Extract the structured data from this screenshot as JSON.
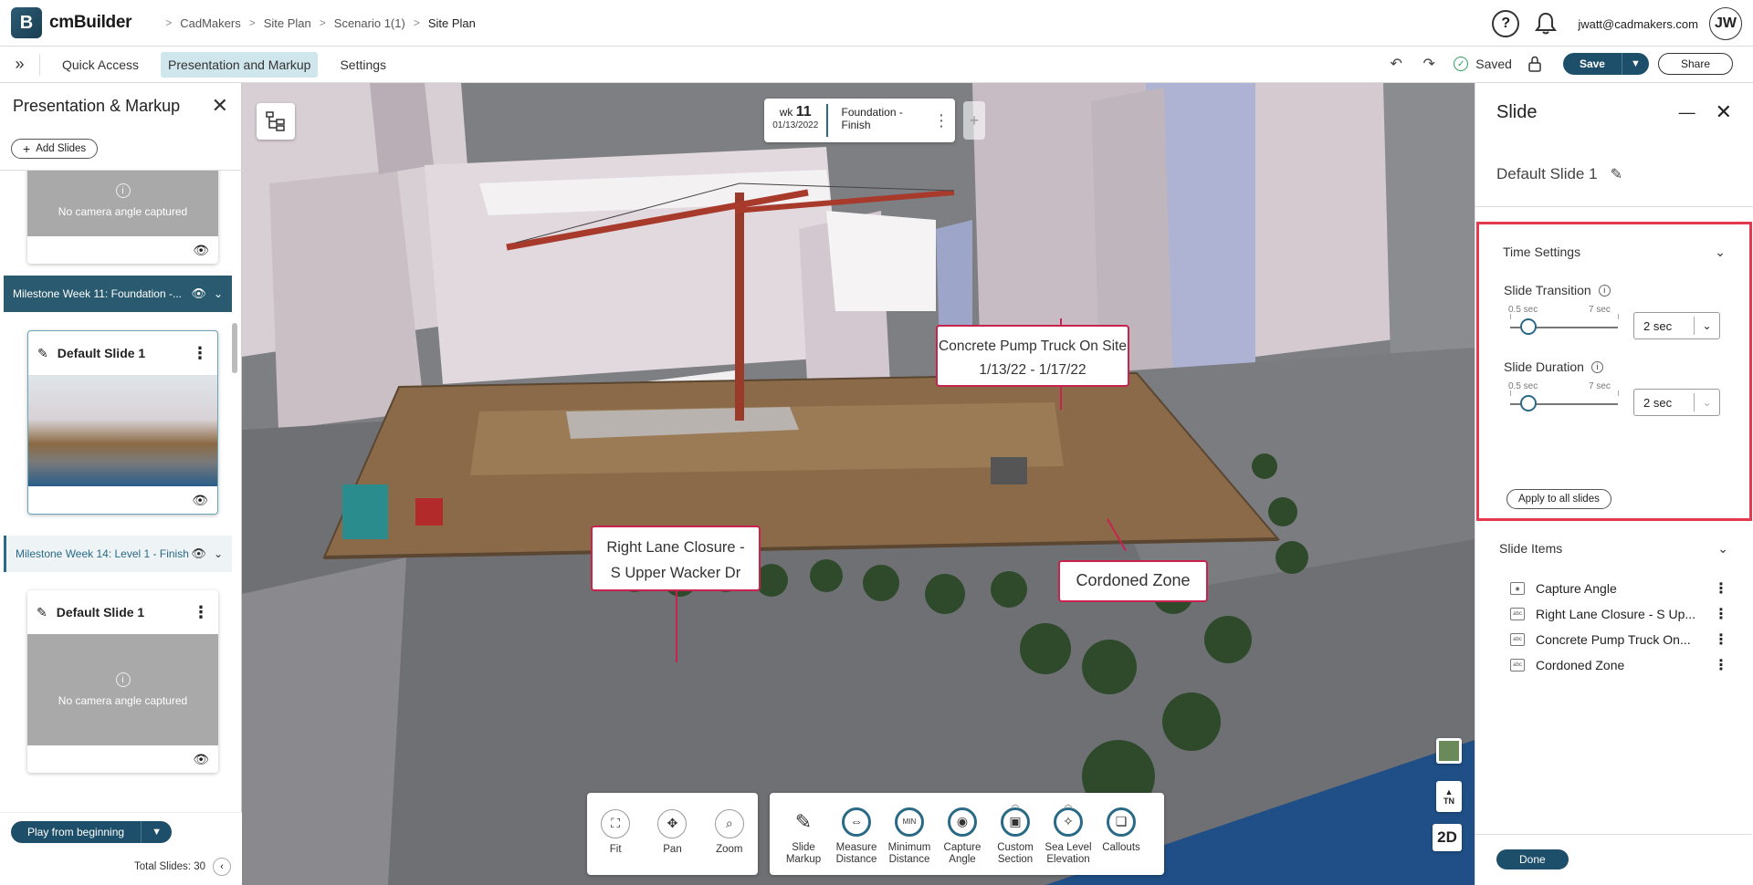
{
  "header": {
    "app_name": "cmBuilder",
    "logo_letter": "B",
    "breadcrumb": [
      "CadMakers",
      "Site Plan",
      "Scenario 1(1)",
      "Site Plan"
    ],
    "help_icon": "?",
    "user_email": "jwatt@cadmakers.com",
    "avatar_initials": "JW"
  },
  "menubar": {
    "expand_icon": "»",
    "items": [
      "Quick Access",
      "Presentation and Markup",
      "Settings"
    ],
    "active_item": "Presentation and Markup",
    "undo_icon": "↶",
    "redo_icon": "↷",
    "saved_label": "Saved",
    "save_label": "Save",
    "share_label": "Share"
  },
  "left_panel": {
    "title": "Presentation & Markup",
    "add_slides_label": "Add Slides",
    "no_camera_text": "No camera angle captured",
    "milestones": [
      {
        "label": "Milestone Week 11: Foundation -..."
      },
      {
        "label": "Milestone Week 14: Level 1 - Finish"
      }
    ],
    "slides": [
      {
        "title": "Default Slide 1"
      },
      {
        "title": "Default Slide 1"
      }
    ],
    "play_label": "Play from beginning",
    "total_slides": "Total Slides: 30"
  },
  "viewport": {
    "timeline": {
      "wk_prefix": "wk",
      "week": "11",
      "date": "01/13/2022",
      "label": "Foundation - Finish"
    },
    "callouts": [
      {
        "line1": "Concrete Pump Truck On Site",
        "line2": "1/13/22 - 1/17/22"
      },
      {
        "line1": "Right Lane Closure -",
        "line2": "S Upper Wacker Dr"
      },
      {
        "line1": "Cordoned Zone",
        "line2": ""
      }
    ],
    "tools_nav": [
      {
        "label": "Fit",
        "icon": "fit-icon"
      },
      {
        "label": "Pan",
        "icon": "pan-icon"
      },
      {
        "label": "Zoom",
        "icon": "zoom-icon"
      }
    ],
    "tools_markup": [
      {
        "label": "Slide\nMarkup",
        "icon": "pencil-icon"
      },
      {
        "label": "Measure\nDistance",
        "icon": "ruler-icon"
      },
      {
        "label": "Minimum\nDistance",
        "icon": "min-distance-icon"
      },
      {
        "label": "Capture\nAngle",
        "icon": "camera-icon"
      },
      {
        "label": "Custom\nSection",
        "icon": "cube-icon"
      },
      {
        "label": "Sea Level\nElevation",
        "icon": "elevation-icon"
      },
      {
        "label": "Callouts",
        "icon": "callout-icon"
      }
    ],
    "compass_label": "TN",
    "mode_2d": "2D"
  },
  "right_panel": {
    "title": "Slide",
    "slide_name": "Default Slide 1",
    "time_settings": {
      "title": "Time Settings",
      "transition": {
        "label": "Slide Transition",
        "min": "0.5 sec",
        "max": "7 sec",
        "value": "2 sec"
      },
      "duration": {
        "label": "Slide Duration",
        "min": "0.5 sec",
        "max": "7 sec",
        "value": "2 sec"
      },
      "apply_label": "Apply to all slides"
    },
    "slide_items": {
      "title": "Slide Items",
      "items": [
        {
          "label": "Capture Angle",
          "icon": "camera-icon"
        },
        {
          "label": "Right Lane Closure - S Up...",
          "icon": "text-box-icon"
        },
        {
          "label": "Concrete Pump Truck On...",
          "icon": "text-box-icon"
        },
        {
          "label": "Cordoned Zone",
          "icon": "text-box-icon"
        }
      ]
    },
    "done_label": "Done"
  }
}
